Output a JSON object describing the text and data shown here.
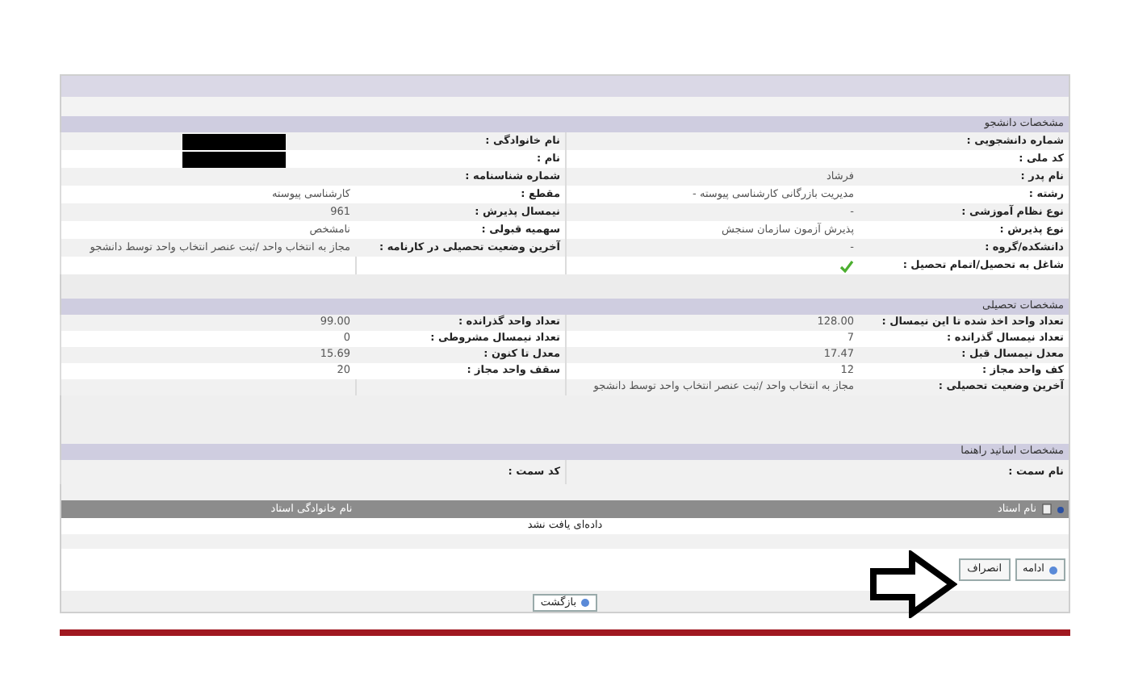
{
  "sections": [
    {
      "title": "مشخصات دانشجو",
      "rows": [
        {
          "right": {
            "label": "شماره دانشجویی :",
            "kind": "text"
          },
          "left": {
            "label": "نام خانوادگی :",
            "kind": "redacted"
          }
        },
        {
          "right": {
            "label": "کد ملی :",
            "kind": "text"
          },
          "left": {
            "label": "نام :",
            "kind": "redacted"
          }
        },
        {
          "right": {
            "label": "نام پدر :",
            "kind": "text",
            "value": "فرشاد"
          },
          "left": {
            "label": "شماره شناسنامه :",
            "kind": "text"
          }
        },
        {
          "right": {
            "label": "رشته :",
            "kind": "text",
            "value": "مدیریت بازرگانی کارشناسی پیوسته -"
          },
          "left": {
            "label": "مقطع :",
            "kind": "text",
            "value": "کارشناسی پیوسته"
          }
        },
        {
          "right": {
            "label": "نوع نظام آموزشی :",
            "kind": "text",
            "value": "-"
          },
          "left": {
            "label": "نیمسال پذیرش :",
            "kind": "text",
            "value": "961"
          }
        },
        {
          "right": {
            "label": "نوع پذیرش :",
            "kind": "text",
            "value": "پذیرش آزمون سازمان سنجش"
          },
          "left": {
            "label": "سهمیه قبولی :",
            "kind": "text",
            "value": "نامشخص"
          }
        },
        {
          "right": {
            "label": "دانشکده/گروه :",
            "kind": "text",
            "value": "-"
          },
          "left": {
            "label": "آخرین وضعیت تحصیلی در کارنامه :",
            "kind": "text",
            "value": "مجاز به انتخاب واحد /ثبت عنصر انتخاب واحد توسط دانشجو"
          }
        },
        {
          "right": {
            "label": "شاغل به تحصیل/اتمام تحصیل :",
            "kind": "check"
          }
        }
      ]
    },
    {
      "title": "مشخصات تحصیلی",
      "rows": [
        {
          "right": {
            "label": "تعداد واحد اخذ شده تا این نیمسال :",
            "kind": "text",
            "value": "128.00"
          },
          "left": {
            "label": "تعداد واحد گذرانده :",
            "kind": "text",
            "value": "99.00"
          }
        },
        {
          "right": {
            "label": "تعداد نیمسال گذرانده :",
            "kind": "text",
            "value": "7"
          },
          "left": {
            "label": "تعداد نیمسال مشروطی :",
            "kind": "text",
            "value": "0"
          }
        },
        {
          "right": {
            "label": "معدل نیمسال قبل :",
            "kind": "text",
            "value": "17.47"
          },
          "left": {
            "label": "معدل تا کنون :",
            "kind": "text",
            "value": "15.69"
          }
        },
        {
          "right": {
            "label": "کف واحد مجاز :",
            "kind": "text",
            "value": "12"
          },
          "left": {
            "label": "سقف واحد مجاز :",
            "kind": "text",
            "value": "20"
          }
        },
        {
          "right": {
            "label": "آخرین وضعیت تحصیلی :",
            "kind": "text",
            "value": "مجاز به انتخاب واحد /ثبت عنصر انتخاب واحد توسط دانشجو"
          }
        }
      ]
    },
    {
      "title": "مشخصات اساتید راهنما",
      "rows": [
        {
          "right": {
            "label": "نام سمت :",
            "kind": "text"
          },
          "left": {
            "label": "کد سمت :",
            "kind": "text"
          }
        }
      ]
    }
  ],
  "advisor_table": {
    "columns": [
      "نام استاد",
      "نام خانوادگی استاد"
    ],
    "empty_message": "داده‌ای یافت نشد"
  },
  "buttons": [
    "ادامه",
    "انصراف"
  ],
  "back_button": "بازگشت"
}
